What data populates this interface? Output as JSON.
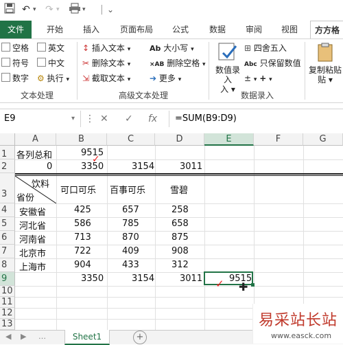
{
  "qat": {
    "save_icon": "save-icon",
    "undo_icon": "undo-icon",
    "redo_icon": "redo-icon",
    "print_icon": "print-icon",
    "more": "⌄"
  },
  "tabs": [
    {
      "label": "文件"
    },
    {
      "label": "开始"
    },
    {
      "label": "插入"
    },
    {
      "label": "页面布局"
    },
    {
      "label": "公式"
    },
    {
      "label": "数据"
    },
    {
      "label": "审阅"
    },
    {
      "label": "视图"
    },
    {
      "label": "方方格"
    }
  ],
  "ribbon": {
    "text_group": {
      "items": [
        "空格",
        "符号",
        "数字",
        "英文",
        "中文",
        "执行"
      ],
      "label": "文本处理"
    },
    "adv_group": {
      "insert_text": "插入文本",
      "delete_text": "删除文本",
      "cut_text": "截取文本",
      "case": "大小写",
      "delete_space": "删除空格",
      "more": "更多",
      "label": "高级文本处理"
    },
    "num_group": {
      "data_entry": "数值录入",
      "round": "四舍五入",
      "keep_value": "只保留数值",
      "label": "数据录入"
    },
    "paste_group": {
      "copy_paste": "复制粘贴"
    }
  },
  "formula_bar": {
    "name_box": "E9",
    "cancel": "✕",
    "confirm": "✓",
    "fx": "fx",
    "formula": "=SUM(B9:D9)"
  },
  "columns": [
    "A",
    "B",
    "C",
    "D",
    "E",
    "F",
    "G"
  ],
  "rows": [
    "1",
    "2",
    "3",
    "4",
    "5",
    "6",
    "7",
    "8",
    "9",
    "10",
    "11",
    "12",
    "13"
  ],
  "cells": {
    "A1": "各列总和",
    "B1": "9515",
    "A2": "0",
    "B2": "3350",
    "C2": "3154",
    "D2": "3011",
    "A3_top": "饮料",
    "A3_bottom": "省份",
    "B3": "可口可乐",
    "C3": "百事可乐",
    "D3": "雪碧",
    "A4": "安徽省",
    "B4": "425",
    "C4": "657",
    "D4": "258",
    "A5": "河北省",
    "B5": "586",
    "C5": "785",
    "D5": "658",
    "A6": "河南省",
    "B6": "713",
    "C6": "870",
    "D6": "875",
    "A7": "北京市",
    "B7": "722",
    "C7": "409",
    "D7": "908",
    "A8": "上海市",
    "B8": "904",
    "C8": "433",
    "D8": "312",
    "B9": "3350",
    "C9": "3154",
    "D9": "3011",
    "E9": "9515"
  },
  "sheet": {
    "name": "Sheet1",
    "add": "+"
  },
  "watermark": {
    "text": "易采站长站",
    "url": "www.easck.com"
  },
  "colors": {
    "excel_green": "#217346",
    "check_red": "#e22"
  }
}
